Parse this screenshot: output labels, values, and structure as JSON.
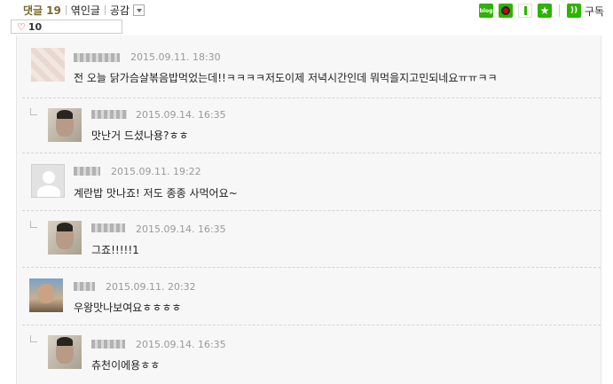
{
  "header": {
    "comment_label": "댓글",
    "comment_count": "19",
    "tab_trackback": "엮인글",
    "tab_empathy": "공감",
    "subscribe_label": "구독",
    "share_icons": [
      "blog-icon",
      "me2day-icon",
      "bookmark-icon",
      "favorite-star-icon",
      "rss-icon"
    ],
    "accent_color": "#2db400"
  },
  "likes": {
    "count": "10"
  },
  "comments": [
    {
      "type": "comment",
      "date": "2015.09.11. 18:30",
      "text": "전 오늘 닭가슴살볶음밥먹었는데!!ㅋㅋㅋㅋ저도이제 저녁시간인데 뭐먹을지고민되네요ㅠㅠㅋㅋ"
    },
    {
      "type": "reply",
      "date": "2015.09.14. 16:35",
      "text": "맛난거 드셨나용?ㅎㅎ"
    },
    {
      "type": "comment",
      "date": "2015.09.11. 19:22",
      "text": "계란밥 맛나죠! 저도 종종 사먹어요~"
    },
    {
      "type": "reply",
      "date": "2015.09.14. 16:35",
      "text": "그죠!!!!!1"
    },
    {
      "type": "comment",
      "date": "2015.09.11. 20:32",
      "text": "우왕맛나보여요ㅎㅎㅎㅎ"
    },
    {
      "type": "reply",
      "date": "2015.09.14. 16:35",
      "text": "츄천이에용ㅎㅎ"
    }
  ]
}
